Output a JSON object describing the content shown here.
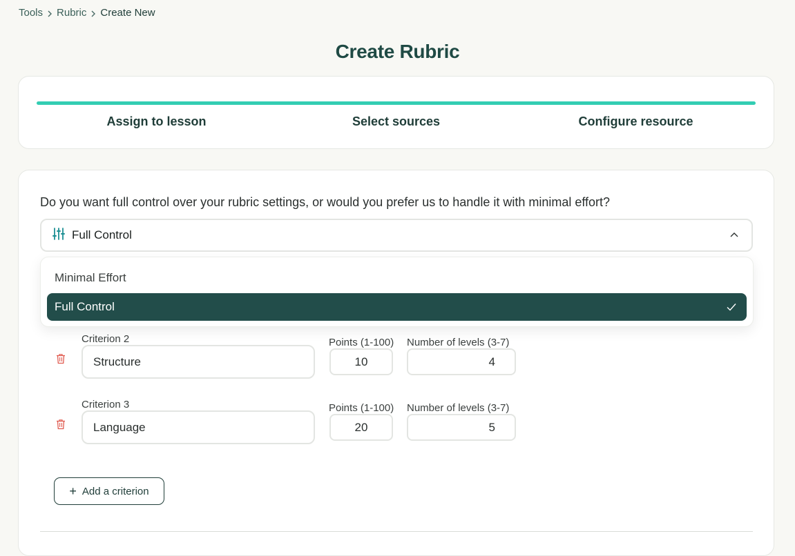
{
  "breadcrumb": {
    "items": [
      "Tools",
      "Rubric",
      "Create New"
    ]
  },
  "page": {
    "title": "Create Rubric"
  },
  "stepper": {
    "progress": 1.0,
    "steps": [
      {
        "label": "Assign to lesson"
      },
      {
        "label": "Select sources"
      },
      {
        "label": "Configure resource"
      }
    ]
  },
  "config": {
    "question": "Do you want full control over your rubric settings, or would you prefer us to handle it with minimal effort?",
    "select_value": "Full Control",
    "select_icon": "sliders-icon",
    "options": [
      {
        "label": "Minimal Effort",
        "selected": false
      },
      {
        "label": "Full Control",
        "selected": true
      }
    ]
  },
  "criteria": [
    {
      "label": "Criterion 2",
      "name": "Structure",
      "points_label": "Points (1-100)",
      "points": "10",
      "levels_label": "Number of levels (3-7)",
      "levels": "4"
    },
    {
      "label": "Criterion 3",
      "name": "Language",
      "points_label": "Points (1-100)",
      "points": "20",
      "levels_label": "Number of levels (3-7)",
      "levels": "5"
    }
  ],
  "actions": {
    "add_criterion": "Add a criterion"
  },
  "colors": {
    "accent": "#33cdb3",
    "primary_dark": "#224d4a",
    "delete": "#e05a4f"
  }
}
